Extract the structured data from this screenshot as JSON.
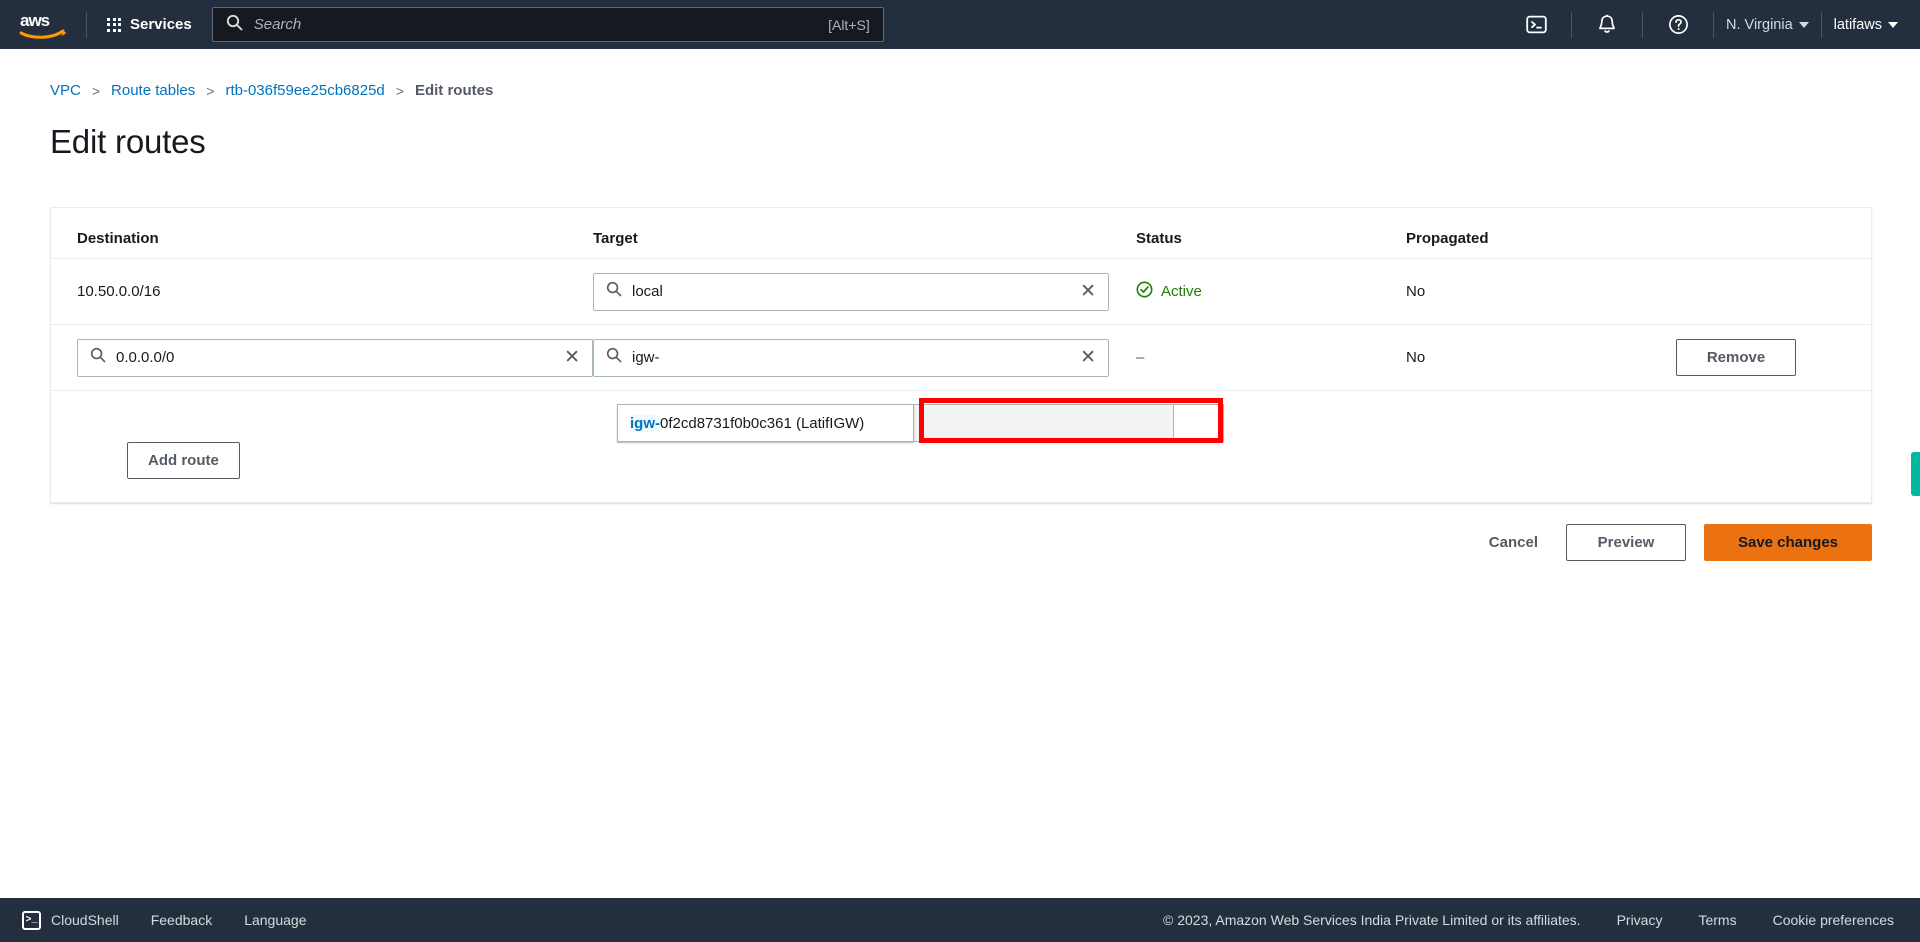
{
  "topnav": {
    "logo_alt": "aws",
    "services_label": "Services",
    "search": {
      "placeholder": "Search",
      "shortcut": "[Alt+S]",
      "value": ""
    },
    "cloudshell_icon": "cloudshell-icon",
    "notifications_icon": "bell-icon",
    "help_icon": "help-icon",
    "region_label": "N. Virginia",
    "account_label": "latifaws"
  },
  "breadcrumb": {
    "items": [
      {
        "label": "VPC",
        "current": false
      },
      {
        "label": "Route tables",
        "current": false
      },
      {
        "label": "rtb-036f59ee25cb6825d",
        "current": false
      },
      {
        "label": "Edit routes",
        "current": true
      }
    ],
    "separator": ">"
  },
  "page": {
    "title": "Edit routes"
  },
  "table": {
    "headers": {
      "destination": "Destination",
      "target": "Target",
      "status": "Status",
      "propagated": "Propagated"
    },
    "rows": [
      {
        "destination": "10.50.0.0/16",
        "destination_editable": false,
        "target": "local",
        "status": "Active",
        "status_type": "active",
        "propagated": "No",
        "action": ""
      },
      {
        "destination": "0.0.0.0/0",
        "destination_editable": true,
        "target": "igw-",
        "status": "–",
        "status_type": "none",
        "propagated": "No",
        "action": "Remove"
      }
    ],
    "add_route_label": "Add route",
    "clear_glyph": "✕"
  },
  "dropdown": {
    "visible": true,
    "option_prefix": "igw-",
    "option_rest": "0f2cd8731f0b0c361 (LatifIGW)"
  },
  "annotation": {
    "color": "#ff0000",
    "shape": "rectangle"
  },
  "actions": {
    "cancel_label": "Cancel",
    "preview_label": "Preview",
    "save_label": "Save changes",
    "save_color": "#ec7211"
  },
  "side_tab": {
    "color": "#00b89f"
  },
  "footer": {
    "cloudshell_label": "CloudShell",
    "feedback_label": "Feedback",
    "language_label": "Language",
    "copyright": "© 2023, Amazon Web Services India Private Limited or its affiliates.",
    "privacy_label": "Privacy",
    "terms_label": "Terms",
    "cookie_label": "Cookie preferences"
  }
}
